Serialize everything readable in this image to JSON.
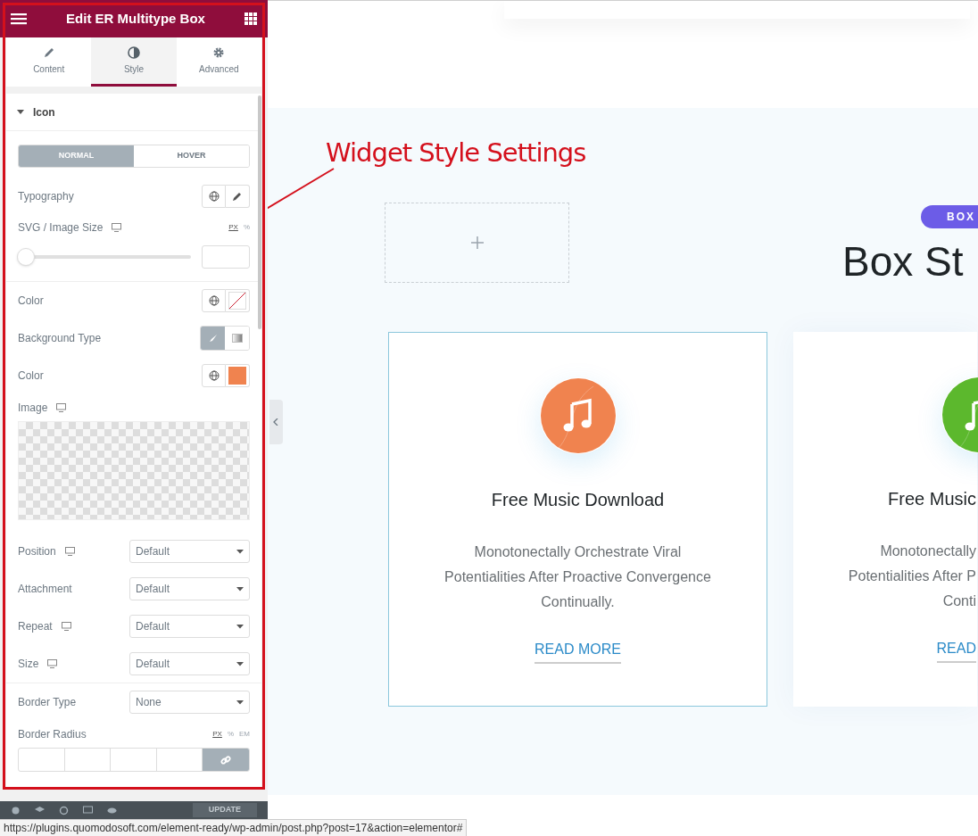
{
  "panel": {
    "title": "Edit ER Multitype Box",
    "tabs": [
      {
        "label": "Content",
        "selected": false
      },
      {
        "label": "Style",
        "selected": true
      },
      {
        "label": "Advanced",
        "selected": false
      }
    ],
    "section": {
      "title": "Icon",
      "expanded": true
    },
    "state_tabs": [
      {
        "label": "NORMAL",
        "selected": true
      },
      {
        "label": "HOVER",
        "selected": false
      }
    ],
    "controls": [
      {
        "kind": "buttons",
        "label": "Typography"
      },
      {
        "kind": "slider",
        "label": "SVG / Image Size",
        "responsive": true,
        "units": [
          {
            "label": "PX",
            "selected": true
          },
          {
            "label": "%",
            "selected": false
          }
        ],
        "level": 0
      },
      {
        "kind": "divider"
      },
      {
        "kind": "color",
        "label": "Color",
        "cleared": true
      },
      {
        "kind": "choose",
        "label": "Background Type",
        "options": [
          {
            "selected": true
          },
          {
            "selected": false
          }
        ]
      },
      {
        "kind": "color",
        "label": "Color",
        "cleared": false,
        "color": "#f0834f"
      },
      {
        "kind": "image",
        "label": "Image",
        "responsive": true
      },
      {
        "kind": "select",
        "label": "Position",
        "responsive": true,
        "value": "Default"
      },
      {
        "kind": "select",
        "label": "Attachment",
        "responsive": false,
        "value": "Default"
      },
      {
        "kind": "select",
        "label": "Repeat",
        "responsive": true,
        "value": "Default"
      },
      {
        "kind": "select",
        "label": "Size",
        "responsive": true,
        "value": "Default"
      },
      {
        "kind": "divider"
      },
      {
        "kind": "select",
        "label": "Border Type",
        "responsive": false,
        "value": "None"
      },
      {
        "kind": "dimensions",
        "label": "Border Radius",
        "units": [
          {
            "label": "PX",
            "selected": true
          },
          {
            "label": "%",
            "selected": false
          },
          {
            "label": "EM",
            "selected": false
          }
        ],
        "linked": true
      }
    ],
    "footer": {
      "button": "UPDATE"
    }
  },
  "status_url": "https://plugins.quomodosoft.com/element-ready/wp-admin/post.php?post=17&action=elementor#",
  "annotation": "Widget Style Settings",
  "canvas": {
    "tag": "BOX",
    "heading": "Box St",
    "cards": [
      {
        "title": "Free Music Download",
        "text": [
          "Monotonectally Orchestrate Viral",
          "Potentialities After Proactive Convergence",
          "Continually."
        ],
        "link": "READ MORE",
        "color": "#f0834f",
        "outlined": true
      },
      {
        "title": "Free Music",
        "text": [
          "Monotonectally",
          "Potentialities After P",
          "Conti"
        ],
        "link": "READ",
        "color": "#5cb82d",
        "outlined": false
      }
    ]
  }
}
